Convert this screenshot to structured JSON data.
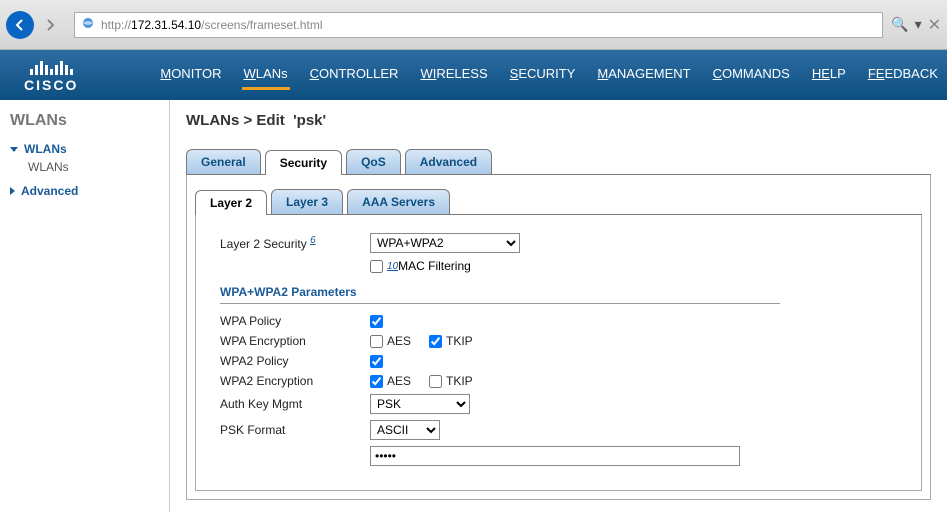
{
  "browser": {
    "url_prefix": "http://",
    "url_host": "172.31.54.10",
    "url_path": "/screens/frameset.html"
  },
  "brand": "CISCO",
  "topnav": [
    {
      "label": "MONITOR",
      "u": "M",
      "rest": "ONITOR"
    },
    {
      "label": "WLANs",
      "u": "W",
      "rest": "LANs",
      "active": true
    },
    {
      "label": "CONTROLLER",
      "u": "C",
      "rest": "ONTROLLER"
    },
    {
      "label": "WIRELESS",
      "u": "WI",
      "rest": "RELESS"
    },
    {
      "label": "SECURITY",
      "u": "S",
      "rest": "ECURITY"
    },
    {
      "label": "MANAGEMENT",
      "u": "M",
      "rest": "ANAGEMENT"
    },
    {
      "label": "COMMANDS",
      "u": "C",
      "rest": "OMMANDS"
    },
    {
      "label": "HELP",
      "u": "HE",
      "rest": "LP"
    },
    {
      "label": "FEEDBACK",
      "u": "FE",
      "rest": "EDBACK"
    }
  ],
  "sidebar": {
    "heading": "WLANs",
    "items": [
      {
        "label": "WLANs",
        "expanded": true,
        "children": [
          {
            "label": "WLANs"
          }
        ]
      },
      {
        "label": "Advanced",
        "expanded": false
      }
    ]
  },
  "page": {
    "breadcrumb": "WLANs > Edit",
    "entity": "'psk'"
  },
  "tabs": {
    "main": [
      "General",
      "Security",
      "QoS",
      "Advanced"
    ],
    "main_active": "Security",
    "sub": [
      "Layer 2",
      "Layer 3",
      "AAA Servers"
    ],
    "sub_active": "Layer 2"
  },
  "form": {
    "l2sec_label": "Layer 2 Security",
    "l2sec_foot": "6",
    "l2sec_value": "WPA+WPA2",
    "macfilter_foot": "10",
    "macfilter_label": "MAC Filtering",
    "macfilter_checked": false,
    "section_heading": "WPA+WPA2 Parameters",
    "rows": {
      "wpa_policy": {
        "label": "WPA Policy",
        "checked": true
      },
      "wpa_enc": {
        "label": "WPA Encryption",
        "aes": false,
        "tkip": true,
        "aes_label": "AES",
        "tkip_label": "TKIP"
      },
      "wpa2_policy": {
        "label": "WPA2 Policy",
        "checked": true
      },
      "wpa2_enc": {
        "label": "WPA2 Encryption",
        "aes": true,
        "tkip": false,
        "aes_label": "AES",
        "tkip_label": "TKIP"
      },
      "auth_key": {
        "label": "Auth Key Mgmt",
        "value": "PSK"
      },
      "psk_format": {
        "label": "PSK Format",
        "value": "ASCII"
      },
      "psk_value": "•••••"
    }
  }
}
